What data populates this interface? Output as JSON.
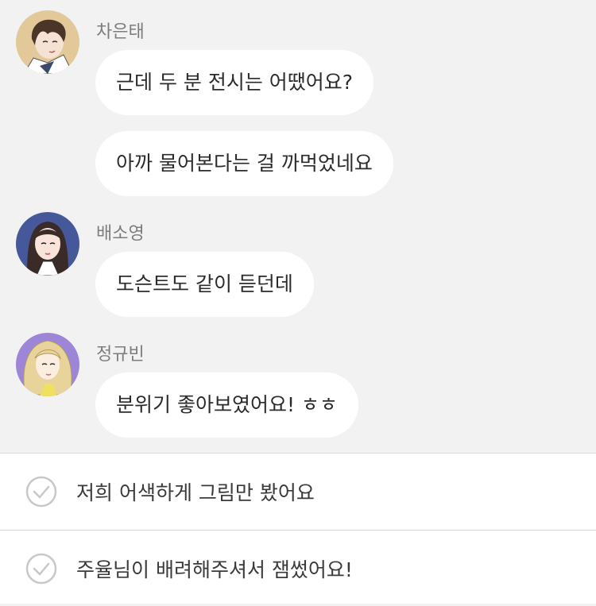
{
  "messages": [
    {
      "sender": "차은태",
      "bubbles": [
        "근데 두 분 전시는 어땠어요?",
        "아까 물어본다는 걸 까먹었네요"
      ]
    },
    {
      "sender": "배소영",
      "bubbles": [
        "도슨트도 같이 듣던데"
      ]
    },
    {
      "sender": "정규빈",
      "bubbles": [
        "분위기 좋아보였어요! ㅎㅎ"
      ]
    }
  ],
  "choices": [
    {
      "label": "저희 어색하게 그림만 봤어요",
      "icon": "check-circle-icon"
    },
    {
      "label": "주율님이 배려해주셔서 잼썼어요!",
      "icon": "check-circle-icon"
    }
  ],
  "colors": {
    "chat_background": "#f2f2f2",
    "bubble": "#ffffff",
    "sender_name": "#7d7d7d",
    "divider": "#d8d8d8",
    "check_icon": "#c8c8c8"
  }
}
